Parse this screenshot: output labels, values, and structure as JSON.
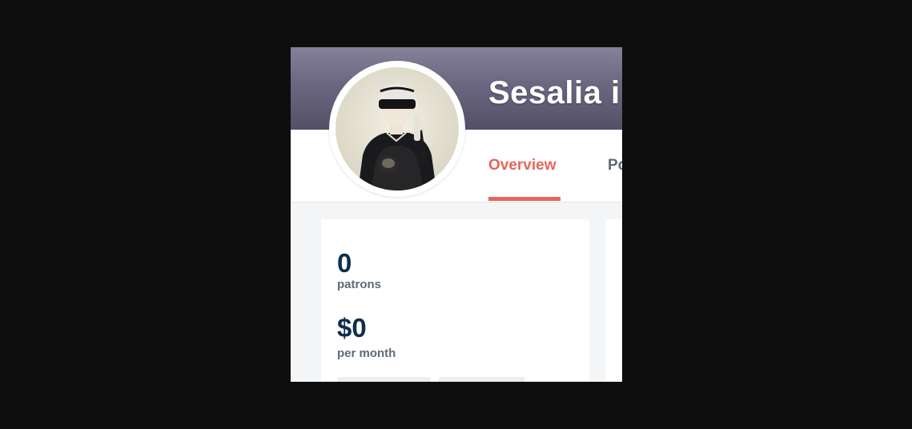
{
  "creator": {
    "name": "Sesalia i"
  },
  "tabs": [
    {
      "label": "Overview",
      "active": true
    },
    {
      "label": "Po",
      "active": false
    }
  ],
  "stats": {
    "patrons_value": "0",
    "patrons_label": "patrons",
    "earnings_value": "$0",
    "earnings_label": "per month"
  },
  "colors": {
    "accent": "#e8665a",
    "heading": "#0f2e4a",
    "muted": "#5d6a78",
    "banner": "#6b6781"
  },
  "icons": {
    "avatar": "character-portrait"
  }
}
